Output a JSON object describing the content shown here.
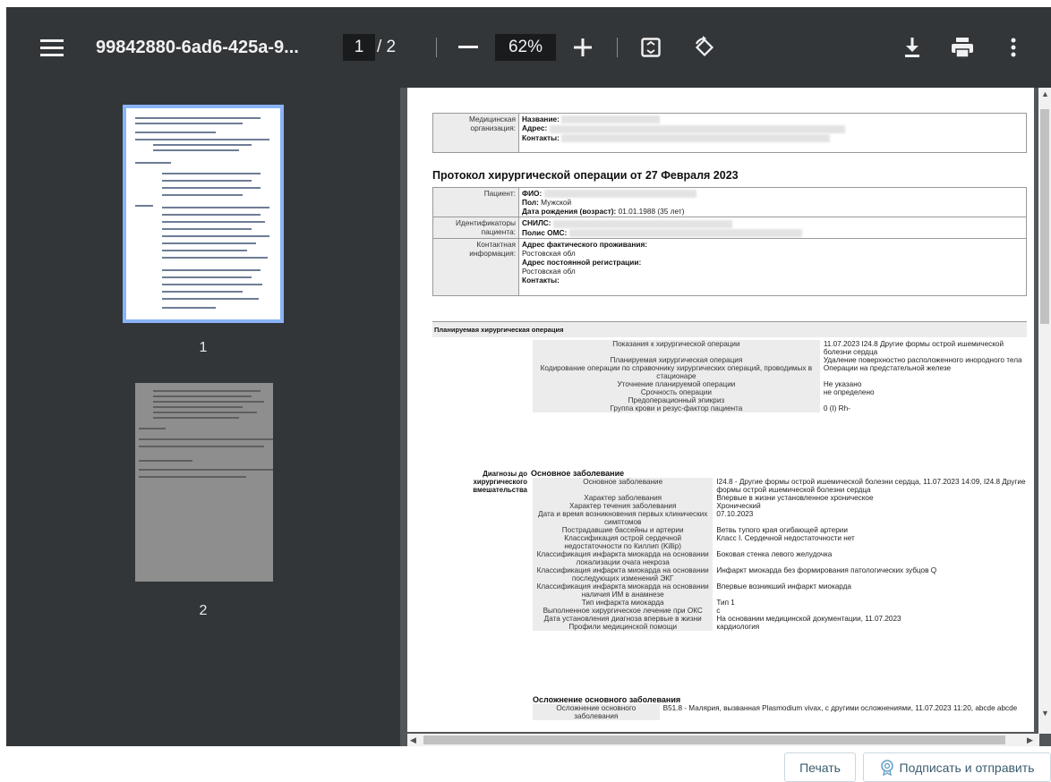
{
  "toolbar": {
    "title": "99842880-6ad6-425a-9...",
    "page_current": "1",
    "page_separator": "/ 2",
    "zoom": "62%"
  },
  "sidebar": {
    "thumbnails": [
      {
        "label": "1"
      },
      {
        "label": "2"
      }
    ]
  },
  "document": {
    "org_label": "Медицинская организация:",
    "org_name_key": "Название:",
    "org_address_key": "Адрес:",
    "org_contacts_key": "Контакты:",
    "protocol_title": "Протокол хирургической операции от 27 Февраля 2023",
    "patient_label": "Пациент:",
    "fio_key": "ФИО:",
    "sex_key": "Пол:",
    "sex_value": "Мужской",
    "dob_key": "Дата рождения (возраст):",
    "dob_value": "01.01.1988 (35 лет)",
    "ids_label": "Идентификаторы пациента:",
    "snils_key": "СНИЛС:",
    "oms_key": "Полис ОМС:",
    "contact_label": "Контактная информация:",
    "actual_address_key": "Адрес фактического проживания:",
    "actual_address_value": "Ростовская обл",
    "permanent_address_key": "Адрес постоянной регистрации:",
    "permanent_address_value": "Ростовская обл",
    "contacts_key": "Контакты:",
    "planned_section": "Планируемая хирургическая операция",
    "planned_rows": [
      {
        "label": "Показания к хирургической операции",
        "value": "11.07.2023 I24.8 Другие формы острой ишемической болезни сердца"
      },
      {
        "label": "Планируемая хирургическая операция",
        "value": "Удаление поверхностно расположенного инородного тела"
      },
      {
        "label": "Кодирование операции по справочнику хирургических операций, проводимых в стационаре",
        "value": "Операции на предстательной железе"
      },
      {
        "label": "Уточнение планируемой операции",
        "value": "Не указано"
      },
      {
        "label": "Срочность операции",
        "value": "не определено"
      },
      {
        "label": "Предоперационный эпикриз",
        "value": ""
      },
      {
        "label": "Группа крови и резус-фактор пациента",
        "value": "0 (I) Rh-"
      }
    ],
    "diag_label": "Диагнозы до хирургического вмешательства",
    "diag_head": "Основное заболевание",
    "diag_rows": [
      {
        "label": "Основное заболевание",
        "value": "I24.8 - Другие формы острой ишемической болезни сердца, 11.07.2023 14:09, I24.8 Другие формы острой ишемической болезни сердца"
      },
      {
        "label": "Характер заболевания",
        "value": "Впервые в жизни установленное хроническое"
      },
      {
        "label": "Характер течения заболевания",
        "value": "Хронический"
      },
      {
        "label": "Дата и время возникновения первых клинических симптомов",
        "value": "07.10.2023"
      },
      {
        "label": "Пострадавшие бассейны и артерии",
        "value": "Ветвь тупого края огибающей артерии"
      },
      {
        "label": "Классификация острой сердечной недостаточности по Киллип (Killip)",
        "value": "Класс I. Сердечной недостаточности нет"
      },
      {
        "label": "Классификация инфаркта миокарда на основании локализации очага некроза",
        "value": "Боковая стенка левого желудочка"
      },
      {
        "label": "Классификация инфаркта миокарда на основании последующих изменений ЭКГ",
        "value": "Инфаркт миокарда без формирования патологических зубцов Q"
      },
      {
        "label": "Классификация инфаркта миокарда на основании наличия ИМ в анамнезе",
        "value": "Впервые возникший инфаркт миокарда"
      },
      {
        "label": "Тип инфаркта миокарда",
        "value": "Тип 1"
      },
      {
        "label": "Выполненное хирургическое лечение при ОКС",
        "value": "с"
      },
      {
        "label": "Дата установления диагноза впервые в жизни",
        "value": "На основании медицинской документации, 11.07.2023"
      },
      {
        "label": "Профили медицинской помощи",
        "value": "кардиология"
      }
    ],
    "comp_head": "Осложнение основного заболевания",
    "comp_rows": [
      {
        "label": "Осложнение основного заболевания",
        "value": "B51.8 - Малярия, вызванная Plasmodium vivax, с другими осложнениями, 11.07.2023 11:20, abcde abcde"
      }
    ]
  },
  "actions": {
    "print_label": "Печать",
    "sign_label": "Подписать и отправить"
  },
  "colors": {
    "toolbar_bg": "#323639",
    "viewer_bg": "#525659",
    "thumb_selected": "#8ab4f8"
  }
}
